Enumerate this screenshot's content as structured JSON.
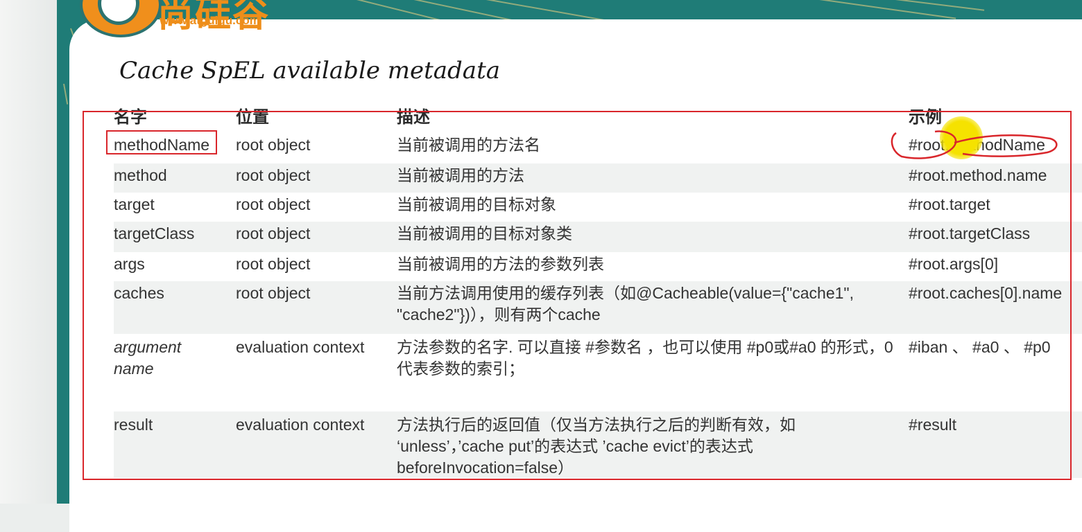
{
  "logo": {
    "text": "尚硅谷",
    "url": "www.atguigu.com"
  },
  "title": "Cache SpEL available metadata",
  "table": {
    "headers": [
      "名字",
      "位置",
      "描述",
      "示例"
    ],
    "rows": [
      {
        "name": "methodName",
        "location": "root object",
        "description": "当前被调用的方法名",
        "example": "#root.methodName"
      },
      {
        "name": "method",
        "location": "root object",
        "description": "当前被调用的方法",
        "example": "#root.method.name"
      },
      {
        "name": "target",
        "location": "root object",
        "description": "当前被调用的目标对象",
        "example": "#root.target"
      },
      {
        "name": "targetClass",
        "location": "root object",
        "description": "当前被调用的目标对象类",
        "example": "#root.targetClass"
      },
      {
        "name": "args",
        "location": "root object",
        "description": "当前被调用的方法的参数列表",
        "example": "#root.args[0]"
      },
      {
        "name": "caches",
        "location": "root object",
        "description": "当前方法调用使用的缓存列表（如@Cacheable(value={\"cache1\", \"cache2\"})），则有两个cache",
        "example": "#root.caches[0].name"
      },
      {
        "name": "argument name",
        "location": "evaluation context",
        "description": "方法参数的名字. 可以直接 #参数名 ，也可以使用 #p0或#a0 的形式，0代表参数的索引；",
        "example": "#iban 、 #a0 、 #p0"
      },
      {
        "name": "result",
        "location": "evaluation context",
        "description": "方法执行后的返回值（仅当方法执行之后的判断有效，如 ‘unless’，’cache put’的表达式 ’cache evict’的表达式 beforeInvocation=false）",
        "example": "#result"
      }
    ]
  },
  "colors": {
    "annotation_red": "#d9262b",
    "pointer_yellow": "#f5e200",
    "brand_orange": "#ee8e1a",
    "teal": "#1f7c77"
  }
}
